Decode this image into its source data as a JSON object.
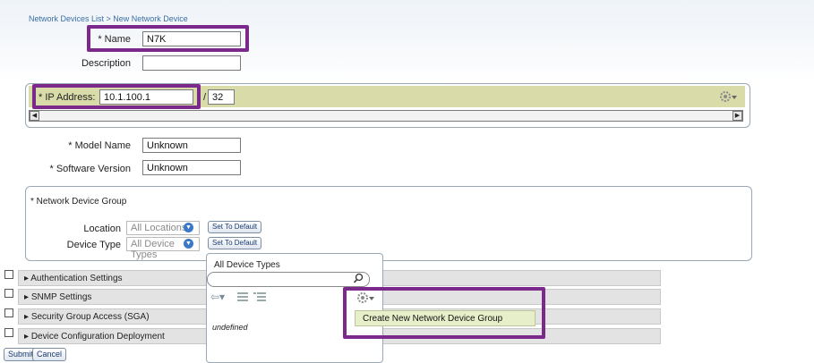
{
  "breadcrumb": "Network Devices List > New Network Device",
  "name": {
    "label": "* Name",
    "value": "N7K"
  },
  "description": {
    "label": "Description",
    "value": ""
  },
  "ip": {
    "label": "* IP Address:",
    "value": "10.1.100.1",
    "separator": "/",
    "mask": "32"
  },
  "model": {
    "label": "* Model Name",
    "value": "Unknown"
  },
  "software": {
    "label": "* Software Version",
    "value": "Unknown"
  },
  "ndg": {
    "title": "* Network Device Group",
    "location": {
      "label": "Location",
      "value": "All Locations",
      "button": "Set To Default"
    },
    "device_type": {
      "label": "Device Type",
      "value": "All Device Types",
      "button": "Set To Default"
    }
  },
  "sections": [
    {
      "label": "Authentication Settings"
    },
    {
      "label": "SNMP Settings"
    },
    {
      "label": "Security Group Access (SGA)"
    },
    {
      "label": "Device Configuration Deployment"
    }
  ],
  "footer": {
    "submit": "Submit",
    "cancel": "Cancel"
  },
  "popup": {
    "title": "All Device Types",
    "search_placeholder": "",
    "tree_text": "undefined",
    "menu_item": "Create New Network Device Group"
  },
  "colors": {
    "highlight": "#7b2a8c",
    "accent": "#3a6ea5"
  },
  "icons": [
    "gear-icon",
    "search-icon",
    "back-arrow-icon",
    "list-view-icon",
    "tree-view-icon",
    "chevron-down-icon"
  ]
}
